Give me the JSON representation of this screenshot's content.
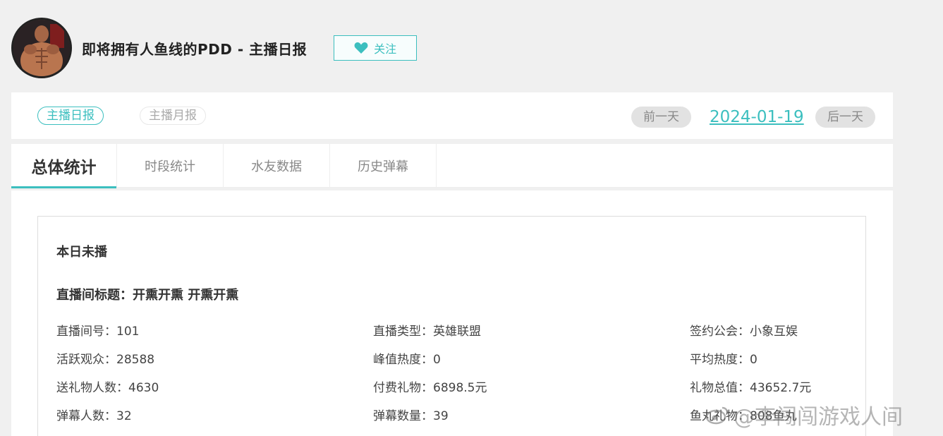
{
  "header": {
    "title": "即将拥有人鱼线的PDD - 主播日报",
    "follow_label": "关注"
  },
  "report_switch": {
    "daily": "主播日报",
    "monthly": "主播月报",
    "prev_day": "前一天",
    "date": "2024-01-19",
    "next_day": "后一天"
  },
  "tabs": [
    {
      "label": "总体统计",
      "active": true
    },
    {
      "label": "时段统计",
      "active": false
    },
    {
      "label": "水友数据",
      "active": false
    },
    {
      "label": "历史弹幕",
      "active": false
    }
  ],
  "summary": {
    "status": "本日未播",
    "room_title": "直播间标题：开熏开熏 开熏开熏",
    "stats": {
      "room_no": "直播间号：101",
      "live_type": "直播类型：英雄联盟",
      "guild": "签约公会：小象互娱",
      "active_viewers": "活跃观众：28588",
      "peak_heat": "峰值热度：0",
      "avg_heat": "平均热度：0",
      "gift_senders": "送礼物人数：4630",
      "paid_gifts": "付费礼物：6898.5元",
      "gift_total": "礼物总值：43652.7元",
      "danmaku_users": "弹幕人数：32",
      "danmaku_count": "弹幕数量：39",
      "fish_ball_gifts": "鱼丸礼物：808鱼丸"
    }
  },
  "watermark": {
    "text": "@李闯闯游戏人间"
  },
  "colors": {
    "accent": "#3cbfbf",
    "background": "#f0f0f0"
  }
}
